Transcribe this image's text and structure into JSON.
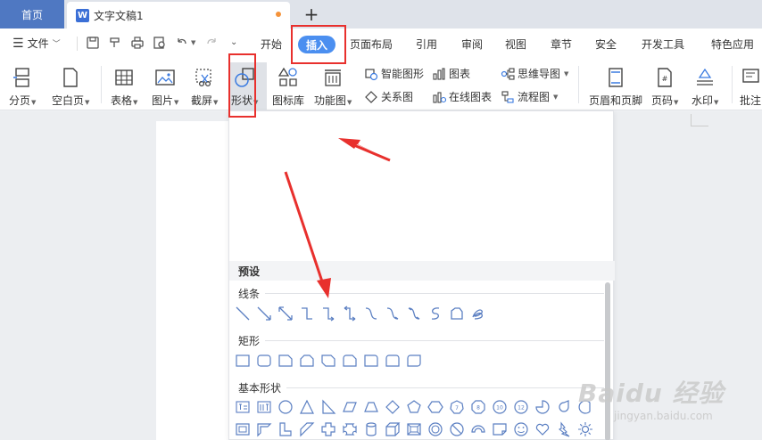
{
  "tabs": {
    "home": "首页",
    "document": "文字文稿1",
    "doc_badge": "W"
  },
  "menu": {
    "file": "文件",
    "tabs": [
      "开始",
      "插入",
      "页面布局",
      "引用",
      "审阅",
      "视图",
      "章节",
      "安全",
      "开发工具",
      "特色应用"
    ],
    "active_tab": "插入"
  },
  "ribbon": {
    "page_break": "分页",
    "blank_page": "空白页",
    "table": "表格",
    "picture": "图片",
    "screenshot": "截屏",
    "shape": "形状",
    "icon_lib": "图标库",
    "func_chart": "功能图",
    "smart_shape": "智能图形",
    "relation": "关系图",
    "chart": "图表",
    "online_chart": "在线图表",
    "mindmap": "思维导图",
    "flowchart": "流程图",
    "header_footer": "页眉和页脚",
    "page_num": "页码",
    "watermark": "水印",
    "comment": "批注"
  },
  "shape_panel": {
    "header": "预设",
    "lines": "线条",
    "rect": "矩形",
    "basic": "基本形状"
  },
  "watermark": {
    "main": "Baidu 经验",
    "sub": "jingyan.baidu.com"
  },
  "colors": {
    "accent": "#4b8ff0",
    "home_tab": "#4f78c2",
    "highlight": "#e8302d",
    "shape_stroke": "#5b7fc2"
  }
}
